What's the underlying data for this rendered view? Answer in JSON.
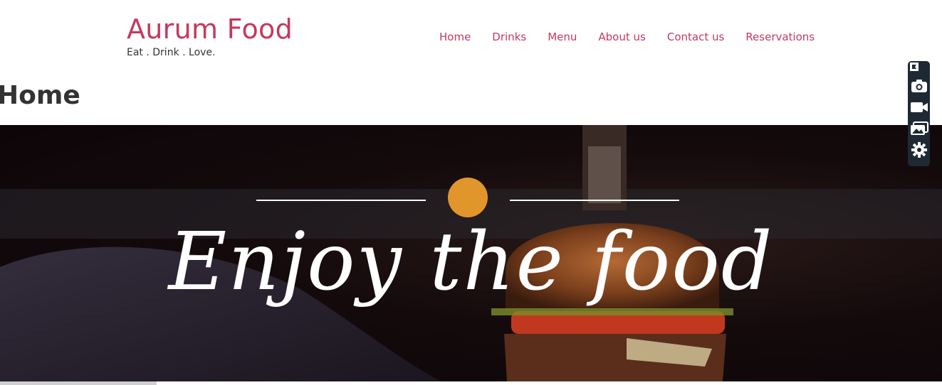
{
  "header": {
    "brand_title": "Aurum Food",
    "tagline": "Eat . Drink . Love.",
    "nav": [
      {
        "label": "Home"
      },
      {
        "label": "Drinks"
      },
      {
        "label": "Menu"
      },
      {
        "label": "About us"
      },
      {
        "label": "Contact us"
      },
      {
        "label": "Reservations"
      }
    ]
  },
  "page": {
    "title": "Home"
  },
  "hero": {
    "headline": "Enjoy the food"
  },
  "colors": {
    "brand": "#c5385f",
    "accent_dot": "#e0962b",
    "toolbar_bg": "#1f2933"
  },
  "toolbar": {
    "icons": [
      "pin-icon",
      "camera-icon",
      "video-icon",
      "gallery-icon",
      "gear-icon"
    ]
  }
}
